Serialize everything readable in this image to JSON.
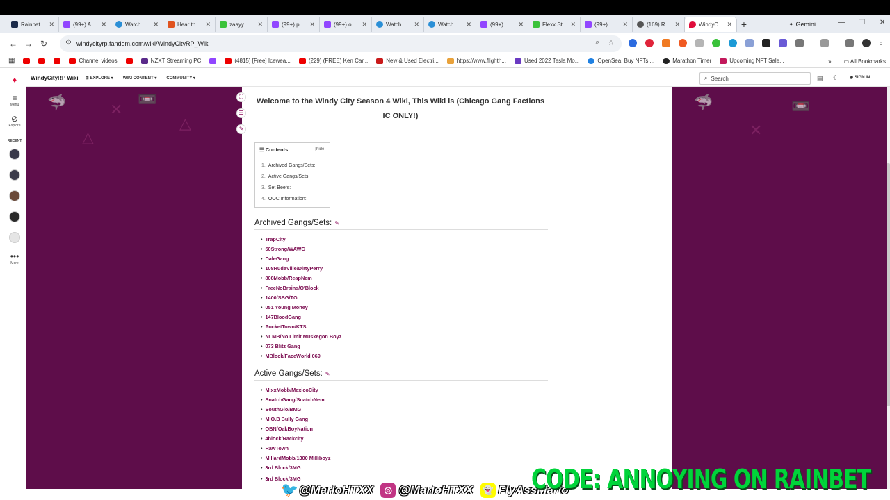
{
  "browser": {
    "tabs": [
      {
        "label": "Rainbet",
        "icon_color": "#1b2a4a"
      },
      {
        "label": "(99+) A",
        "icon_color": "#9146ff"
      },
      {
        "label": "Watch",
        "icon_color": "#2b8fd6"
      },
      {
        "label": "Hear th",
        "icon_color": "#e0531f"
      },
      {
        "label": "zaayy",
        "icon_color": "#3ac23a"
      },
      {
        "label": "(99+) p",
        "icon_color": "#9146ff"
      },
      {
        "label": "(99+) o",
        "icon_color": "#9146ff"
      },
      {
        "label": "Watch",
        "icon_color": "#2b8fd6"
      },
      {
        "label": "Watch",
        "icon_color": "#2b8fd6"
      },
      {
        "label": "(99+)",
        "icon_color": "#9146ff"
      },
      {
        "label": "Flexx St",
        "icon_color": "#3ac23a"
      },
      {
        "label": "(99+)",
        "icon_color": "#9146ff"
      },
      {
        "label": "(169) R",
        "icon_color": "#555555"
      },
      {
        "label": "WindyC",
        "icon_color": "#e00d3b"
      }
    ],
    "gemini_label": "Gemini",
    "url": "windycityrp.fandom.com/wiki/WindyCityRP_Wiki",
    "bookmarks": [
      {
        "label": ""
      },
      {
        "label": ""
      },
      {
        "label": ""
      },
      {
        "label": "Channel videos"
      },
      {
        "label": ""
      },
      {
        "label": "NZXT Streaming PC"
      },
      {
        "label": ""
      },
      {
        "label": "(4815) [Free] Icewea..."
      },
      {
        "label": "(229) (FREE) Ken Car..."
      },
      {
        "label": "New & Used Electri..."
      },
      {
        "label": "https://www.flighth..."
      },
      {
        "label": "Used 2022 Tesla Mo..."
      },
      {
        "label": "OpenSea: Buy NFTs,..."
      },
      {
        "label": "Marathon Timer"
      },
      {
        "label": "Upcoming NFT Sale..."
      }
    ],
    "all_bookmarks": "All Bookmarks"
  },
  "fandom_nav": {
    "menu": "Menu",
    "explore": "Explore",
    "recent": "RECENT",
    "more": "More"
  },
  "wiki_header": {
    "name": "WindyCityRP Wiki",
    "explore": "EXPLORE",
    "wiki_content": "WIKI CONTENT",
    "community": "COMMUNITY",
    "search_placeholder": "Search",
    "sign_in": "SIGN IN"
  },
  "article": {
    "welcome": "Welcome to the Windy City Season 4 Wiki, This Wiki is (Chicago Gang Factions IC ONLY!)",
    "toc": {
      "title": "Contents",
      "hide": "[hide]",
      "items": [
        {
          "n": "1.",
          "label": "Archived Gangs/Sets:"
        },
        {
          "n": "2.",
          "label": "Active Gangs/Sets:"
        },
        {
          "n": "3.",
          "label": "Set Beefs:"
        },
        {
          "n": "4.",
          "label": "OOC Information:"
        }
      ]
    },
    "archived_heading": "Archived Gangs/Sets:",
    "archived": [
      "TrapCity",
      "50Strong/WAWG",
      "DaleGang",
      "108RudeVille/DirtyPerry",
      "808Mobb/ReapNem",
      "FreeNoBrains/O'Block",
      "1400/SBG/TG",
      "051 Young Money",
      "147BloodGang",
      "PocketTown/KTS",
      "NLMB/No Limit Muskegon Boyz",
      "073 Blitz Gang",
      "MBlock/FaceWorld 069"
    ],
    "active_heading": "Active Gangs/Sets:",
    "active": [
      "MixxMobb/MexicoCity",
      "SnatchGang/SnatchNem",
      "SouthGlo/BMG",
      "M.O.B Bully Gang",
      "OBN/OakBoyNation",
      "4block/Rackcity",
      "RawTown",
      "MillardMobb/1300 Milliboyz",
      "3rd Block/3MG",
      "3rd Block/3MG"
    ]
  },
  "overlay": {
    "twitter": "@MarioHTXX",
    "instagram": "@MarioHTXX",
    "snapchat": "FlyAssMario",
    "promo": "CODE: ANNOYING ON RAINBET"
  }
}
